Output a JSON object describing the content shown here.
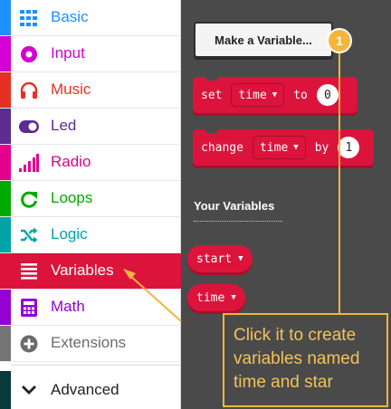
{
  "sidebar": {
    "categories": [
      {
        "label": "Basic",
        "color": "#1e90ff",
        "icon": "grid-icon"
      },
      {
        "label": "Input",
        "color": "#d400d4",
        "icon": "radio-target-icon"
      },
      {
        "label": "Music",
        "color": "#e63022",
        "icon": "headphones-icon"
      },
      {
        "label": "Led",
        "color": "#5c2d91",
        "icon": "toggle-icon"
      },
      {
        "label": "Radio",
        "color": "#e3008c",
        "icon": "signal-bars-icon"
      },
      {
        "label": "Loops",
        "color": "#00aa00",
        "icon": "loop-arrow-icon"
      },
      {
        "label": "Logic",
        "color": "#00a4a6",
        "icon": "shuffle-icon"
      },
      {
        "label": "Variables",
        "color": "#dc143c",
        "icon": "list-lines-icon"
      },
      {
        "label": "Math",
        "color": "#9400d3",
        "icon": "calculator-icon"
      },
      {
        "label": "Extensions",
        "color": "#757575",
        "icon": "plus-circle-icon"
      },
      {
        "label": "Advanced",
        "color": "#0b3a3a",
        "icon": "chevron-down-icon"
      }
    ],
    "selected": "Variables"
  },
  "flyout": {
    "make_variable_label": "Make a Variable...",
    "set_block": {
      "keyword": "set",
      "variable": "time",
      "to_word": "to",
      "value": "0"
    },
    "change_block": {
      "keyword": "change",
      "variable": "time",
      "by_word": "by",
      "value": "1"
    },
    "section_title": "Your Variables",
    "variables": [
      "start",
      "time"
    ]
  },
  "annotation": {
    "step_number": "1",
    "text": "Click it to create variables named time and star",
    "color": "#f2b53c"
  }
}
